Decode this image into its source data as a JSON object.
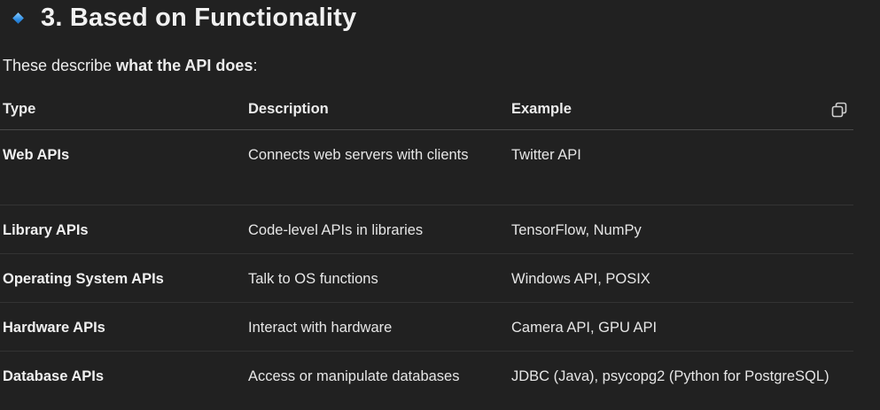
{
  "heading": {
    "icon": "small-blue-diamond-icon",
    "title": "3. Based on Functionality"
  },
  "intro": {
    "prefix": "These describe ",
    "bold": "what the API does",
    "suffix": ":"
  },
  "table": {
    "headers": [
      "Type",
      "Description",
      "Example"
    ],
    "copy_icon": "copy-icon",
    "rows": [
      {
        "type": "Web APIs",
        "description": "Connects web servers with clients",
        "example": "Twitter API"
      },
      {
        "type": "Library APIs",
        "description": "Code-level APIs in libraries",
        "example": "TensorFlow, NumPy"
      },
      {
        "type": "Operating System APIs",
        "description": "Talk to OS functions",
        "example": "Windows API, POSIX"
      },
      {
        "type": "Hardware APIs",
        "description": "Interact with hardware",
        "example": "Camera API, GPU API"
      },
      {
        "type": "Database APIs",
        "description": "Access or manipulate databases",
        "example": "JDBC (Java), psycopg2 (Python for PostgreSQL)"
      }
    ]
  },
  "colors": {
    "background": "#212121",
    "text": "#ececec",
    "diamond": "#2f8fe6"
  }
}
